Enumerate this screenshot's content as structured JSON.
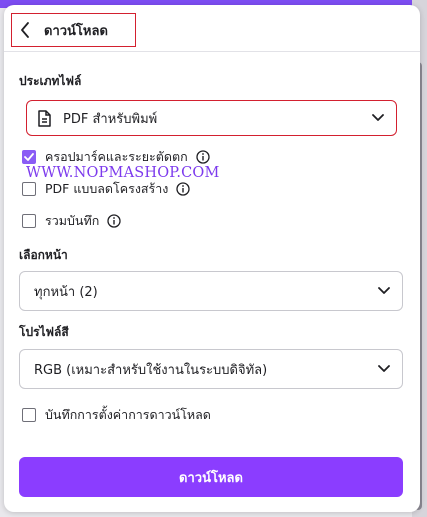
{
  "header": {
    "title": "ดาวน์โหลด"
  },
  "file_type": {
    "label": "ประเภทไฟล์",
    "selected": "PDF สำหรับพิมพ์",
    "options": [
      {
        "label": "ครอปมาร์คและระยะตัดตก",
        "checked": true
      },
      {
        "label": "PDF แบบลดโครงสร้าง",
        "checked": false
      },
      {
        "label": "รวมบันทึก",
        "checked": false
      }
    ]
  },
  "watermark": "WWW.NOPMASHOP.COM",
  "pages": {
    "label": "เลือกหน้า",
    "selected": "ทุกหน้า (2)"
  },
  "color_profile": {
    "label": "โปรไฟล์สี",
    "selected": "RGB (เหมาะสำหรับใช้งานในระบบดิจิทัล)"
  },
  "save_settings": {
    "label": "บันทึกการตั้งค่าการดาวน์โหลด",
    "checked": false
  },
  "download_button": {
    "label": "ดาวน์โหลด"
  },
  "colors": {
    "accent": "#8b3dff",
    "highlight_border": "#d3202f"
  }
}
